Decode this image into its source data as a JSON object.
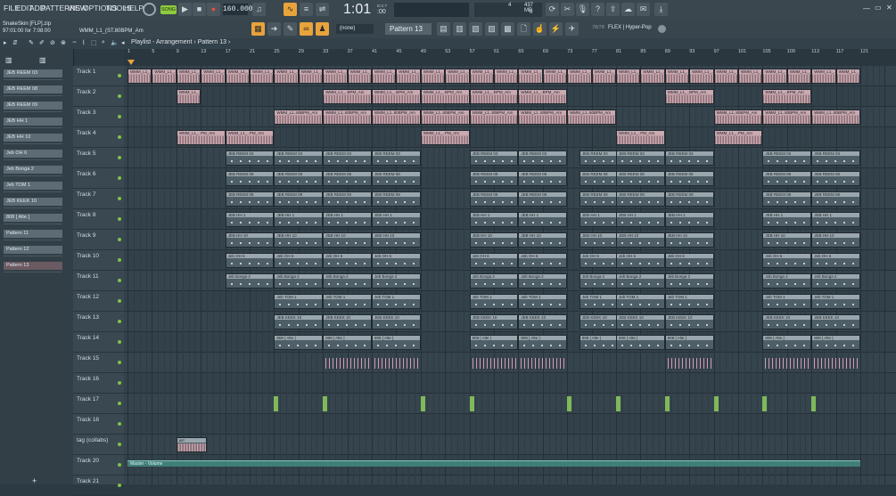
{
  "menu": {
    "items": [
      "FILE",
      "EDIT",
      "ADD",
      "PATTERNS",
      "VIEW",
      "OPTIONS",
      "TOOLS",
      "HELP"
    ]
  },
  "transport": {
    "mode_label": "SONG",
    "tempo": "160.000",
    "time": "1:01",
    "time_sub": ":00",
    "bst_label": "B:S:T",
    "cpu_pattern": "4",
    "memory": "437 MB",
    "memory_sub": "0"
  },
  "project": {
    "filename": "SnakeSkin [FLP].zip",
    "time_info": "97:01:00 for 7:08:00",
    "hint": "WMM_L1_(ST.80BPM_Am"
  },
  "toolbar2": {
    "snap": "(none)",
    "pattern_selector": "Pattern 13",
    "plugin_info": "FLEX | Hyper-Pop",
    "cpu_label": "78/78"
  },
  "playlist": {
    "breadcrumb": "Playlist - Arrangement › Pattern 13 ›"
  },
  "ruler": {
    "marks": [
      "1",
      "5",
      "9",
      "13",
      "17",
      "21",
      "25",
      "29",
      "33",
      "37",
      "41",
      "45",
      "49",
      "53",
      "57",
      "61",
      "65",
      "69",
      "73",
      "77",
      "81",
      "85",
      "89",
      "93",
      "97",
      "101",
      "105",
      "109",
      "113",
      "117",
      "121"
    ]
  },
  "browser": {
    "patterns": [
      "JEB REEM 03",
      "JEB REEM 08",
      "JEB REEM 09",
      "JEB HH 1",
      "JEB HH 10",
      "Jeb OH 6",
      "Jeb Bonga 2",
      "Jeb TOM 1",
      "JEB KEEK 10",
      "808 [ Alte ]",
      "Pattern 11",
      "Pattern 12",
      "Pattern 13"
    ]
  },
  "tracks": [
    "Track 1",
    "Track 2",
    "Track 3",
    "Track 4",
    "Track 5",
    "Track 6",
    "Track 7",
    "Track 8",
    "Track 9",
    "Track 10",
    "Track 11",
    "Track 12",
    "Track 13",
    "Track 14",
    "Track 15",
    "Track 16",
    "Track 17",
    "Track 18",
    "tag (collabs)",
    "Track 20",
    "Track 21"
  ],
  "clip_labels": {
    "audio": "WMM_L1_..BPM_Am",
    "audio3": "WMM_L1..80BPM_Am",
    "audio4": "WMM_L1_..PM_Am",
    "t5": "JEB REEM 03",
    "t6": "JEB REEM 08",
    "t7": "JEB REEM 09",
    "t8": "JEB HH 1",
    "t9": "JEB HH 10",
    "t10": "Jeb OH 6",
    "t11": "Jeb Bonga 2",
    "t12": "Jeb TOM 1",
    "t13": "JEB KEEK 10",
    "t14": "808 [ Alte ]",
    "tag": "wrr",
    "automation": "Master - Volume"
  },
  "colors": {
    "accent": "#e8a33c",
    "bg": "#34434c",
    "led": "#7ec24a"
  }
}
